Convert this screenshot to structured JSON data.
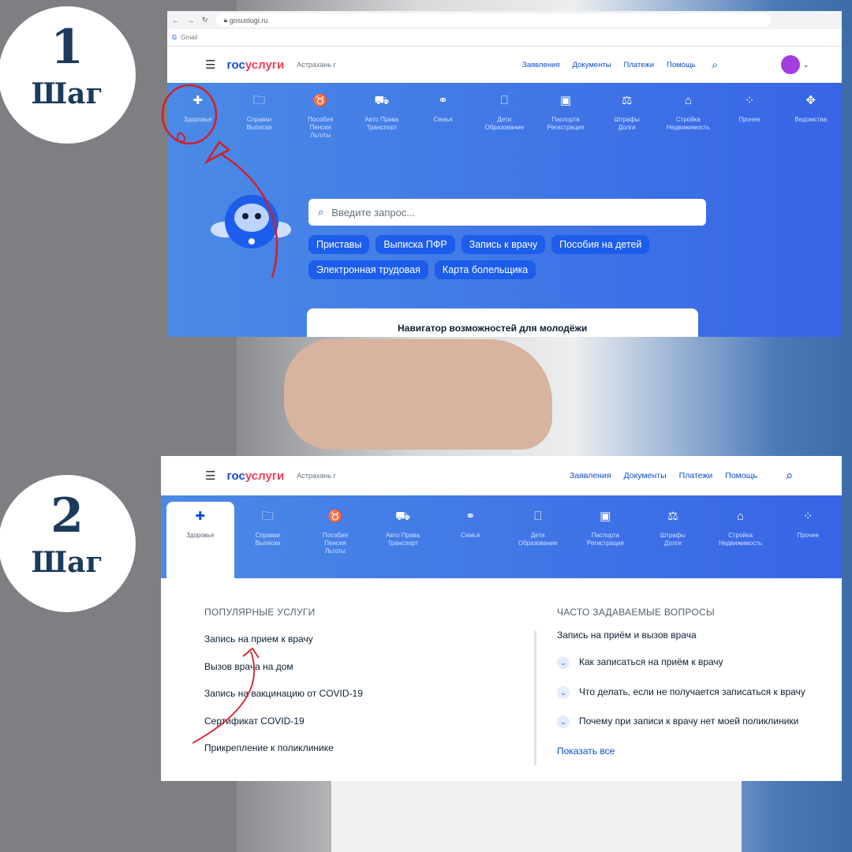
{
  "steps": [
    {
      "num": "1",
      "label": "Шаг"
    },
    {
      "num": "2",
      "label": "Шаг"
    }
  ],
  "browser": {
    "url": "gosuslugi.ru",
    "bookmark": "Gmail"
  },
  "header": {
    "logo_a": "гос",
    "logo_b": "услуги",
    "city": "Астрахань г",
    "nav": [
      "Заявления",
      "Документы",
      "Платежи",
      "Помощь"
    ]
  },
  "categories": [
    {
      "icon": "plus-icon",
      "glyph": "✚",
      "l1": "Здоровье",
      "l2": "",
      "l3": ""
    },
    {
      "icon": "folder-icon",
      "glyph": "🗀",
      "l1": "Справки",
      "l2": "Выписки",
      "l3": ""
    },
    {
      "icon": "bag-icon",
      "glyph": "♉",
      "l1": "Пособия",
      "l2": "Пенсия",
      "l3": "Льготы"
    },
    {
      "icon": "car-icon",
      "glyph": "⛟",
      "l1": "Авто Права",
      "l2": "Транспорт",
      "l3": ""
    },
    {
      "icon": "stroller-icon",
      "glyph": "⚭",
      "l1": "Семья",
      "l2": "",
      "l3": ""
    },
    {
      "icon": "book-icon",
      "glyph": "⎕",
      "l1": "Дети",
      "l2": "Образование",
      "l3": ""
    },
    {
      "icon": "passport-icon",
      "glyph": "▣",
      "l1": "Паспорта",
      "l2": "Регистрация",
      "l3": ""
    },
    {
      "icon": "gavel-icon",
      "glyph": "⚖",
      "l1": "Штрафы",
      "l2": "Долги",
      "l3": ""
    },
    {
      "icon": "house-icon",
      "glyph": "⌂",
      "l1": "Стройка",
      "l2": "Недвижимость",
      "l3": ""
    },
    {
      "icon": "grid-icon",
      "glyph": "⁘",
      "l1": "Прочее",
      "l2": "",
      "l3": ""
    },
    {
      "icon": "emblem-icon",
      "glyph": "✥",
      "l1": "Ведомства",
      "l2": "",
      "l3": ""
    }
  ],
  "search": {
    "placeholder": "Введите запрос..."
  },
  "chips": [
    "Приставы",
    "Выписка ПФР",
    "Запись к врачу",
    "Пособия на детей",
    "Электронная трудовая",
    "Карта болельщика"
  ],
  "banner": "Навигатор возможностей для молодёжи",
  "popular": {
    "title": "ПОПУЛЯРНЫЕ УСЛУГИ",
    "items": [
      "Запись на прием к врачу",
      "Вызов врача на дом",
      "Запись на вакцинацию от COVID-19",
      "Сертификат COVID-19",
      "Прикрепление к поликлинике"
    ]
  },
  "faq": {
    "title": "ЧАСТО ЗАДАВАЕМЫЕ ВОПРОСЫ",
    "subtitle": "Запись на приём и вызов врача",
    "items": [
      "Как записаться на приём к врачу",
      "Что делать, если не получается записаться к врачу",
      "Почему при записи к врачу нет моей поликлиники"
    ],
    "more": "Показать все"
  },
  "colors": {
    "brand": "#0d4cd3",
    "accent": "#ee3f58",
    "annotation": "#d0202a"
  }
}
